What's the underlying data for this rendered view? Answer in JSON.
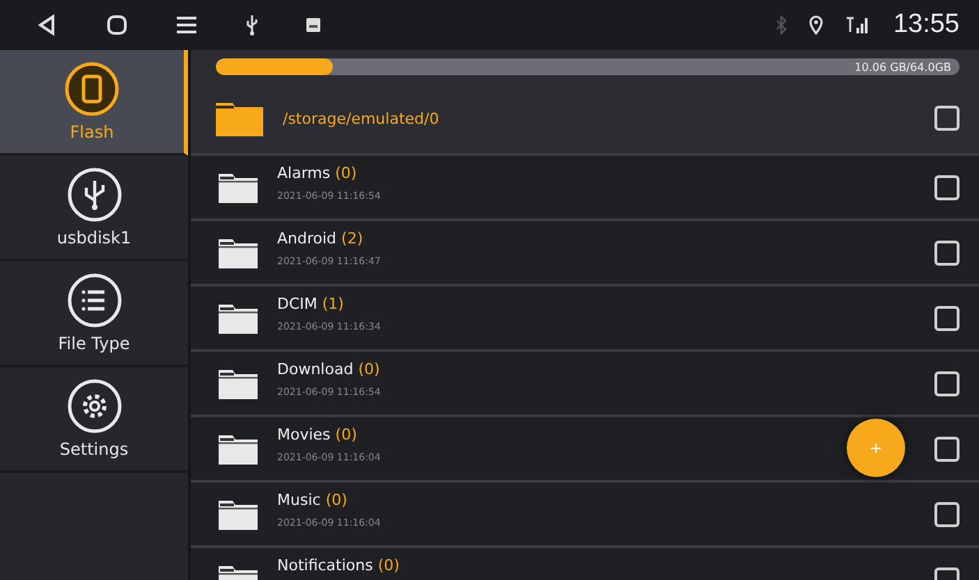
{
  "status_bar": {
    "time": "13:55"
  },
  "sidebar": {
    "items": [
      {
        "label": "Flash",
        "kind": "phone",
        "selected": true
      },
      {
        "label": "usbdisk1",
        "kind": "usb",
        "selected": false
      },
      {
        "label": "File Type",
        "kind": "list",
        "selected": false
      },
      {
        "label": "Settings",
        "kind": "gear",
        "selected": false
      }
    ]
  },
  "storage": {
    "level": 0.157,
    "reading": "10.06 GB/64.0GB"
  },
  "path": {
    "text": "/storage/emulated/0",
    "checked": false
  },
  "files": [
    {
      "name": "Alarms",
      "count": "(0)",
      "date": "2021-06-09 11:16:54",
      "checked": false
    },
    {
      "name": "Android",
      "count": "(2)",
      "date": "2021-06-09 11:16:47",
      "checked": false
    },
    {
      "name": "DCIM",
      "count": "(1)",
      "date": "2021-06-09 11:16:34",
      "checked": false
    },
    {
      "name": "Download",
      "count": "(0)",
      "date": "2021-06-09 11:16:54",
      "checked": false
    },
    {
      "name": "Movies",
      "count": "(0)",
      "date": "2021-06-09 11:16:04",
      "checked": false
    },
    {
      "name": "Music",
      "count": "(0)",
      "date": "2021-06-09 11:16:04",
      "checked": false
    },
    {
      "name": "Notifications",
      "count": "(0)",
      "checked": false
    }
  ],
  "fab": {
    "label": "+"
  }
}
